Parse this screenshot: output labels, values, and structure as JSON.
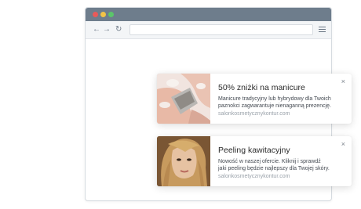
{
  "browser": {
    "nav_back": "←",
    "nav_forward": "→",
    "nav_reload": "↻"
  },
  "notifications": [
    {
      "title": "50% zniżki na manicure",
      "body_line1": "Manicure tradycyjny lub hybrydowy dla Twoich",
      "body_line2": "paznokci zagwarantuje nienaganną prezencję.",
      "url": "salonkosmetycznykontur.com",
      "close": "×",
      "image": "manicure-photo"
    },
    {
      "title": "Peeling kawitacyjny",
      "body_line1": "Nowość w naszej ofercie. Kliknij i sprawdź",
      "body_line2": "jaki peeling będzie najlepszy dla Twojej skóry.",
      "url": "salonkosmetycznykontur.com",
      "close": "×",
      "image": "woman-portrait-photo"
    }
  ],
  "colors": {
    "titlebar": "#6e7d8c",
    "dot_red": "#e85a5a",
    "dot_yellow": "#f2c347",
    "dot_green": "#5bc56a"
  }
}
